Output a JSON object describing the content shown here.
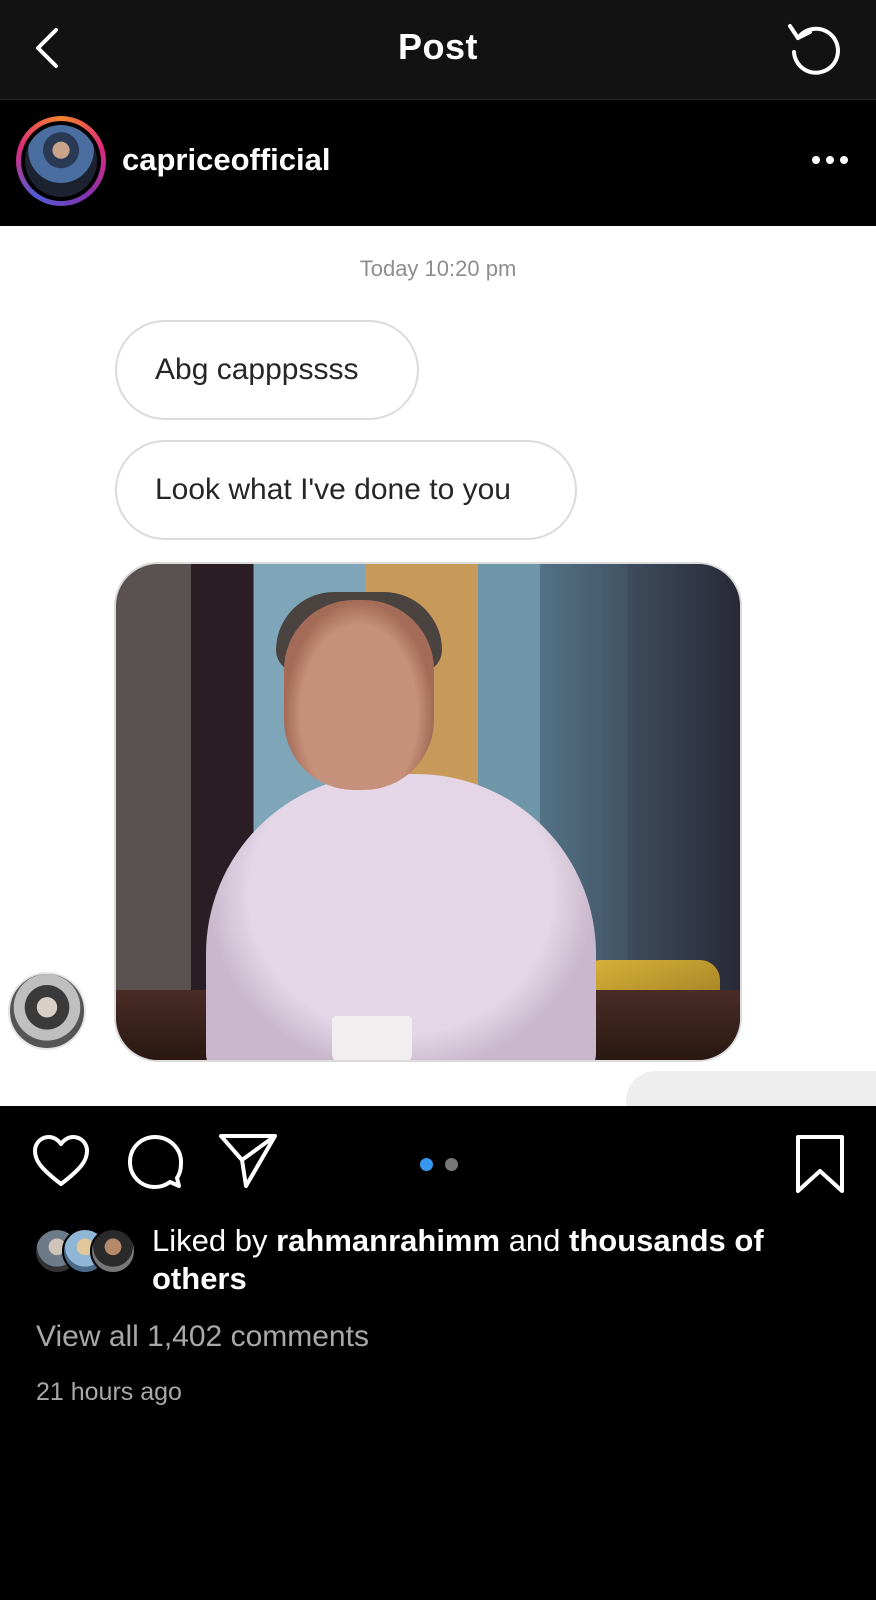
{
  "header": {
    "title": "Post"
  },
  "post": {
    "username": "capriceofficial"
  },
  "dm": {
    "timestamp": "Today 10:20 pm",
    "messages": [
      "Abg capppssss",
      "Look what I've done to you"
    ]
  },
  "carousel": {
    "pages": 2,
    "active_index": 0
  },
  "likes": {
    "prefix": "Liked by",
    "user": "rahmanrahimm",
    "joiner": "and",
    "suffix": "thousands of others"
  },
  "comments": {
    "view_all": "View all 1,402 comments"
  },
  "time_ago": "21 hours ago",
  "colors": {
    "accent_blue": "#3897f0",
    "background": "#000000",
    "topbar": "#121212"
  }
}
